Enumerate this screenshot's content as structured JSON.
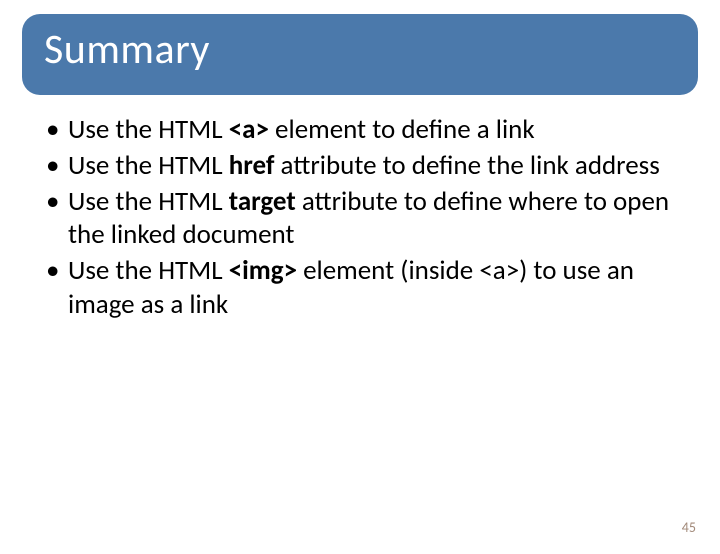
{
  "title": "Summary",
  "bullets": [
    {
      "pre": "Use the HTML ",
      "bold": "<a>",
      "post": " element to define a link"
    },
    {
      "pre": "Use the HTML ",
      "bold": "href",
      "post": " attribute to define the link address"
    },
    {
      "pre": "Use the HTML ",
      "bold": "target",
      "post": " attribute to define where to open the linked document"
    },
    {
      "pre": "Use the HTML ",
      "bold": "<img>",
      "post": " element (inside <a>) to use an image as a link"
    }
  ],
  "page_number": "45"
}
